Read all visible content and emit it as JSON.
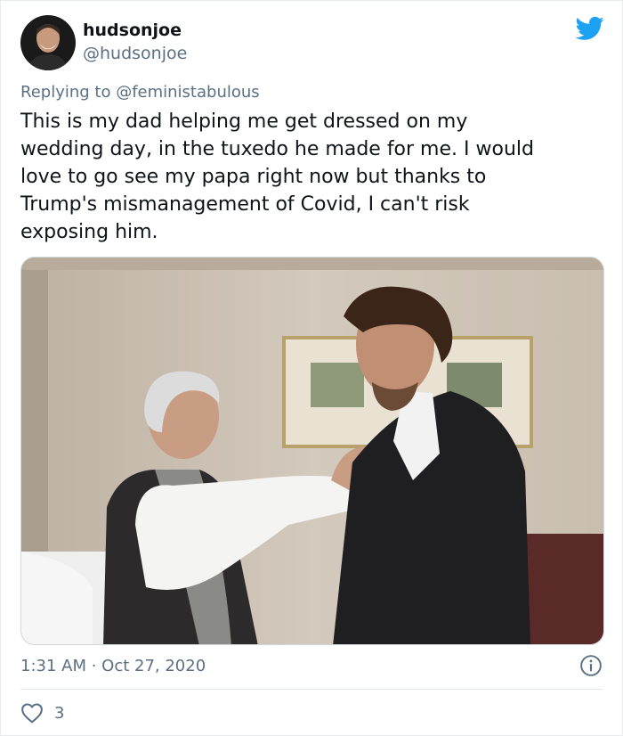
{
  "tweet": {
    "display_name": "hudsonjoe",
    "handle": "@hudsonjoe",
    "reply_prefix": "Replying to ",
    "reply_to": "@feministabulous",
    "text": "This is my dad helping me get dressed on my\nwedding day, in the tuxedo he made for me. I would\nlove to go see my papa right now but thanks to\nTrump's mismanagement of Covid, I can't risk\nexposing him.",
    "timestamp": "1:31 AM · Oct 27, 2020",
    "like_count": "3"
  },
  "icons": {
    "brand": "twitter-bird-icon",
    "info": "info-icon",
    "like": "heart-icon"
  },
  "colors": {
    "brand_blue": "#1da1f2",
    "secondary_text": "#5b7083",
    "primary_text": "#0f1419"
  }
}
